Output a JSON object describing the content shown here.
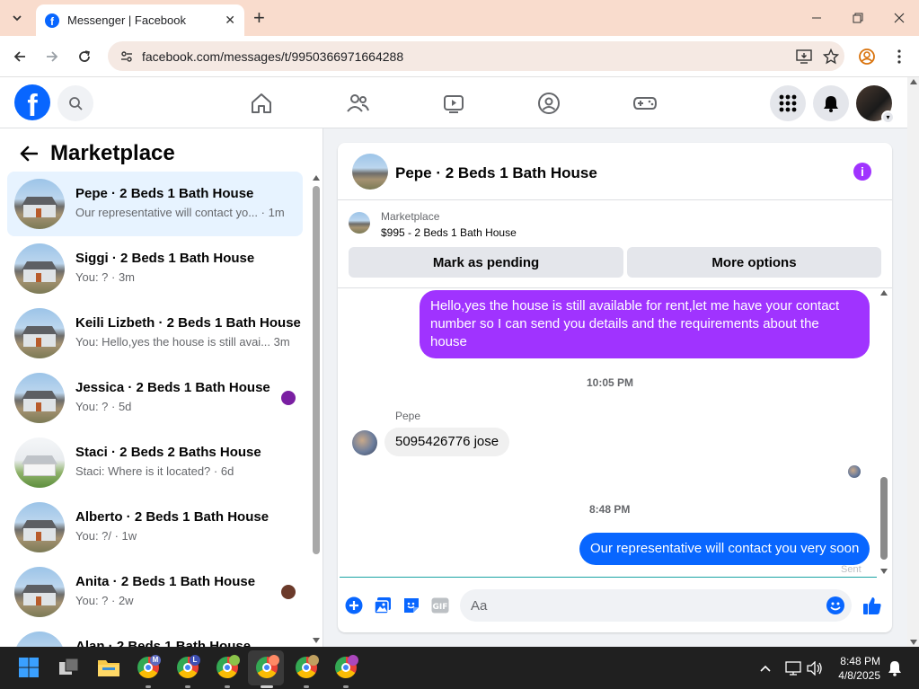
{
  "browser": {
    "tab_title": "Messenger | Facebook",
    "url": "facebook.com/messages/t/9950366971664288"
  },
  "fb_nav": {
    "logo_letter": "f"
  },
  "left_panel": {
    "title": "Marketplace",
    "conversations": [
      {
        "name": "Pepe · 2 Beds 1 Bath House",
        "preview": "Our representative will contact yo... · 1m",
        "active": true
      },
      {
        "name": "Siggi · 2 Beds 1 Bath House",
        "preview": "You: ? · 3m"
      },
      {
        "name": "Keili Lizbeth · 2 Beds 1 Bath House",
        "preview": "You: Hello,yes the house is still avai... 3m"
      },
      {
        "name": "Jessica · 2 Beds 1 Bath House",
        "preview": "You: ? · 5d",
        "seen_color": "#7a1fa2"
      },
      {
        "name": "Staci · 2 Beds 2 Baths House",
        "preview": "Staci: Where is it located? · 6d"
      },
      {
        "name": "Alberto · 2 Beds 1 Bath House",
        "preview": "You: ?/ · 1w"
      },
      {
        "name": "Anita · 2 Beds 1 Bath House",
        "preview": "You: ? · 2w",
        "seen_color": "#6b3a2a"
      },
      {
        "name": "Alan · 2 Beds 1 Bath House",
        "preview": ""
      }
    ]
  },
  "chat": {
    "title": "Pepe · 2 Beds 1 Bath House",
    "listing_source": "Marketplace",
    "listing_title": "$995 - 2 Beds 1 Bath House",
    "mark_pending_label": "Mark as pending",
    "more_options_label": "More options",
    "messages": {
      "outgoing_1": "Hello,yes the house is still available for rent,let me have your contact number   so I can send you details and the requirements about the house",
      "timestamp_1": "10:05 PM",
      "sender_name": "Pepe",
      "incoming_1": "5095426776 jose",
      "timestamp_2": "8:48 PM",
      "outgoing_2": "Our representative will contact you very soon",
      "sent_label": "Sent"
    },
    "composer_placeholder": "Aa",
    "accent_color": "#a033ff"
  },
  "taskbar": {
    "time": "8:48 PM",
    "date": "4/8/2025",
    "chrome_badges": [
      "M",
      "L",
      "",
      "",
      "",
      ""
    ]
  }
}
